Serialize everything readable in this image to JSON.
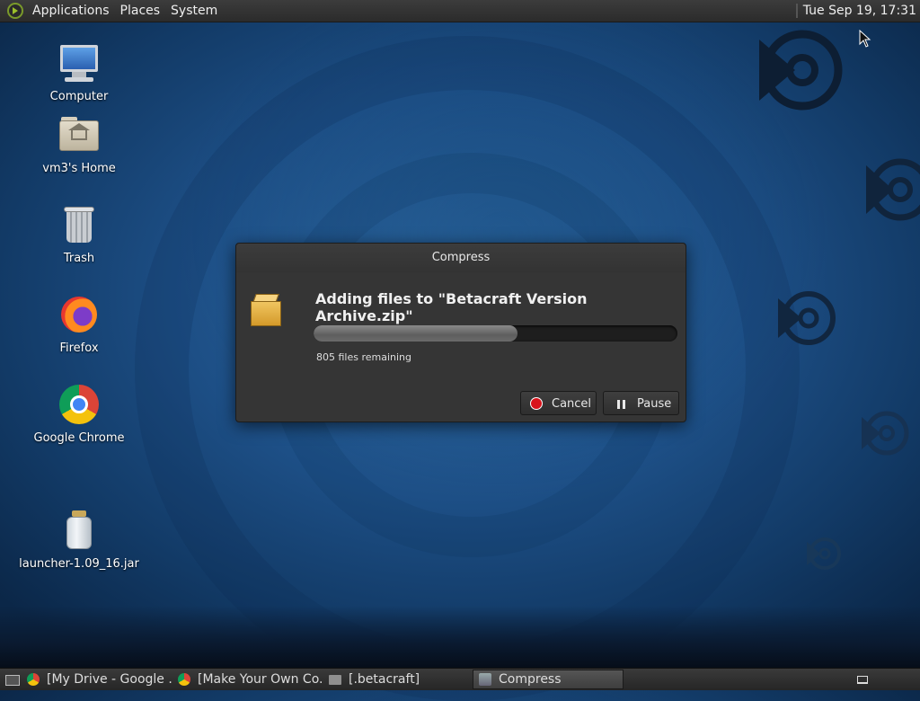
{
  "top_panel": {
    "menus": [
      "Applications",
      "Places",
      "System"
    ],
    "clock": "Tue Sep 19, 17:31"
  },
  "desktop": {
    "icons": [
      {
        "label": "Computer",
        "icon": "computer-icon"
      },
      {
        "label": "vm3's Home",
        "icon": "home-folder-icon"
      },
      {
        "label": "Trash",
        "icon": "trash-icon"
      },
      {
        "label": "Firefox",
        "icon": "firefox-icon"
      },
      {
        "label": "Google Chrome",
        "icon": "chrome-icon"
      },
      {
        "label": "launcher-1.09_16.jar",
        "icon": "jar-file-icon"
      }
    ]
  },
  "dialog": {
    "title": "Compress",
    "heading": "Adding files to \"Betacraft Version Archive.zip\"",
    "progress": 0.56,
    "remaining": "805 files remaining",
    "cancel_label": "Cancel",
    "pause_label": "Pause"
  },
  "taskbar": {
    "items": [
      {
        "label": "[My Drive - Google ...",
        "icon": "chrome-icon",
        "active": false
      },
      {
        "label": "[Make Your Own Co...",
        "icon": "chrome-icon",
        "active": false
      },
      {
        "label": "[.betacraft]",
        "icon": "folder-icon",
        "active": false
      },
      {
        "label": "Compress",
        "icon": "compress-icon",
        "active": true
      }
    ]
  },
  "colors": {
    "accent_cancel": "#d8131b",
    "dialog_bg": "#353535",
    "panel_bg": "#2b2b2b"
  }
}
